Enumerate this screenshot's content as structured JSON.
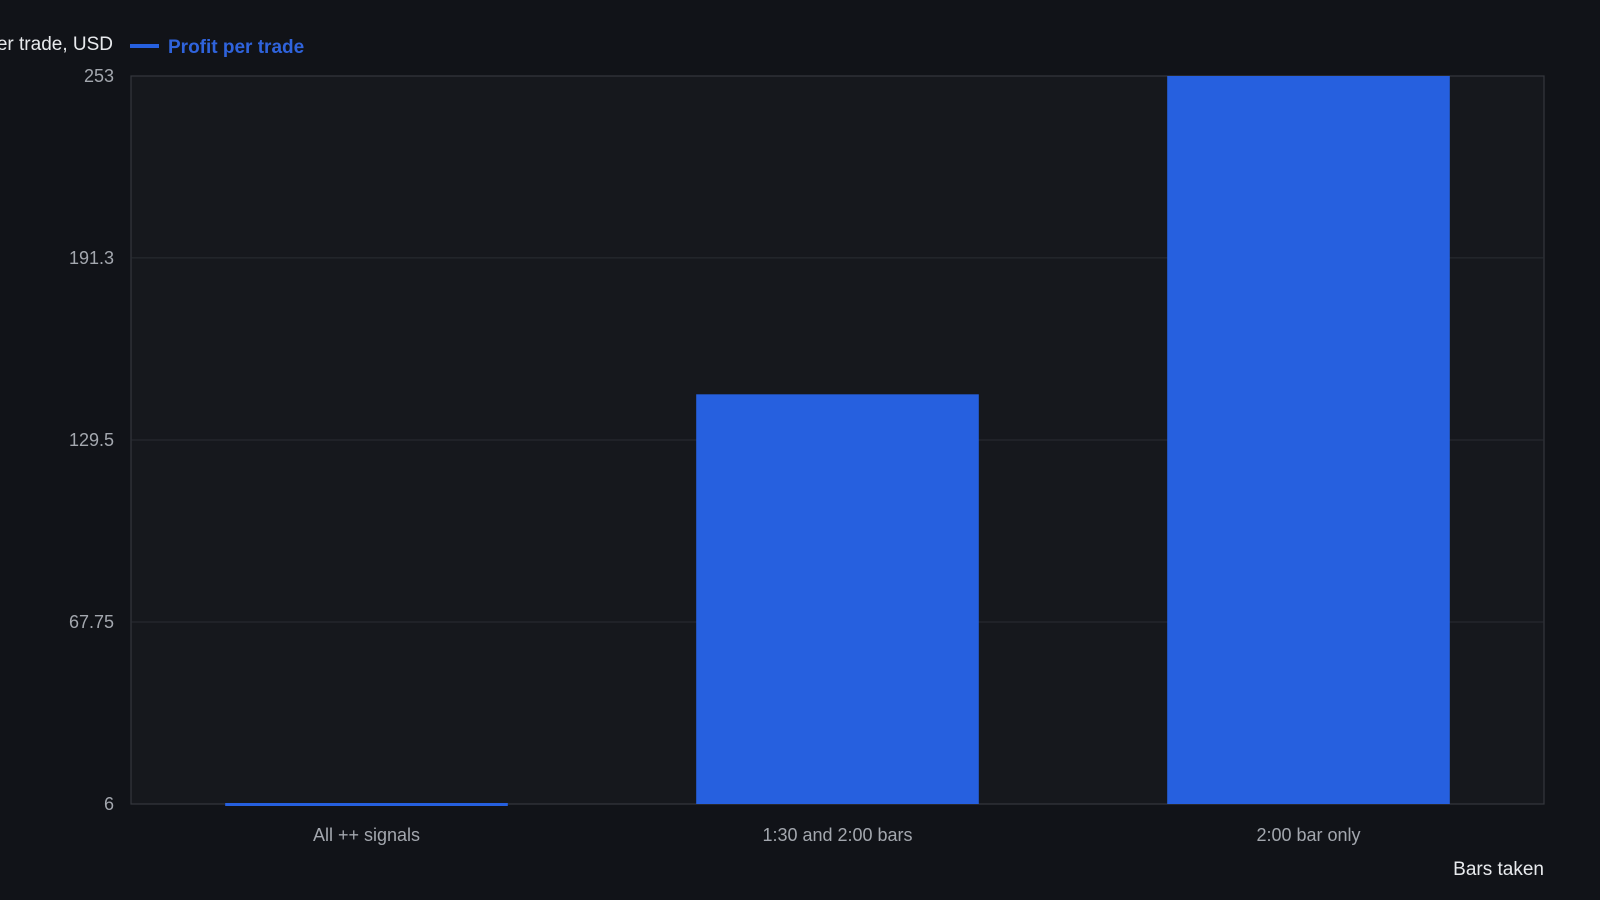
{
  "chart_data": {
    "type": "bar",
    "ylabel": "Profit per trade, USD",
    "xlabel": "Bars taken",
    "categories": [
      "All ++ signals",
      "1:30 and 2:00 bars",
      "2:00 bar only"
    ],
    "series": [
      {
        "name": "Profit per trade",
        "values": [
          6,
          145,
          253
        ]
      }
    ],
    "ylim": [
      6,
      253
    ],
    "yticks": [
      "6",
      "67.75",
      "129.5",
      "191.3",
      "253"
    ],
    "legend_position": "top-left",
    "grid": true
  },
  "colors": {
    "background": "#111318",
    "plot_background": "#16181d",
    "gridline": "#2a2d33",
    "axis_border": "#34373e",
    "bar": "#2660df",
    "tick_text": "#a3a7ae",
    "title_text": "#e8eaed",
    "legend_text": "#2f63dc"
  }
}
